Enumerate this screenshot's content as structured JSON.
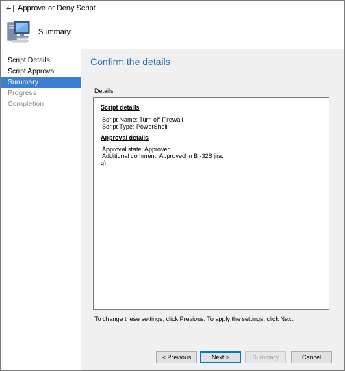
{
  "window": {
    "title": "Approve or Deny Script"
  },
  "header": {
    "title": "Summary"
  },
  "sidebar": {
    "items": [
      {
        "label": "Script Details",
        "state": "normal"
      },
      {
        "label": "Script Approval",
        "state": "normal"
      },
      {
        "label": "Summary",
        "state": "active"
      },
      {
        "label": "Progress",
        "state": "disabled"
      },
      {
        "label": "Completion",
        "state": "disabled"
      }
    ]
  },
  "main": {
    "title": "Confirm the details",
    "details_label": "Details:",
    "details": {
      "script_heading": "Script details",
      "script_name": "Script Name: Turn off Firewall",
      "script_type": "Script Type: PowerShell",
      "approval_heading": "Approval details",
      "approval_state": "Approval state: Approved",
      "additional_comment": "Additional comment: Approved in BI-328 jira.",
      "trailing": "g)"
    },
    "hint": "To change these settings, click Previous. To apply the settings, click Next."
  },
  "buttons": {
    "previous": "< Previous",
    "next": "Next >",
    "summary": "Summary",
    "cancel": "Cancel"
  },
  "colors": {
    "accent": "#2e74b5",
    "selection": "#3a7fd2",
    "background": "#f0f0f0"
  },
  "icons": {
    "title": "dialog-app-icon",
    "header": "computer-icon"
  }
}
